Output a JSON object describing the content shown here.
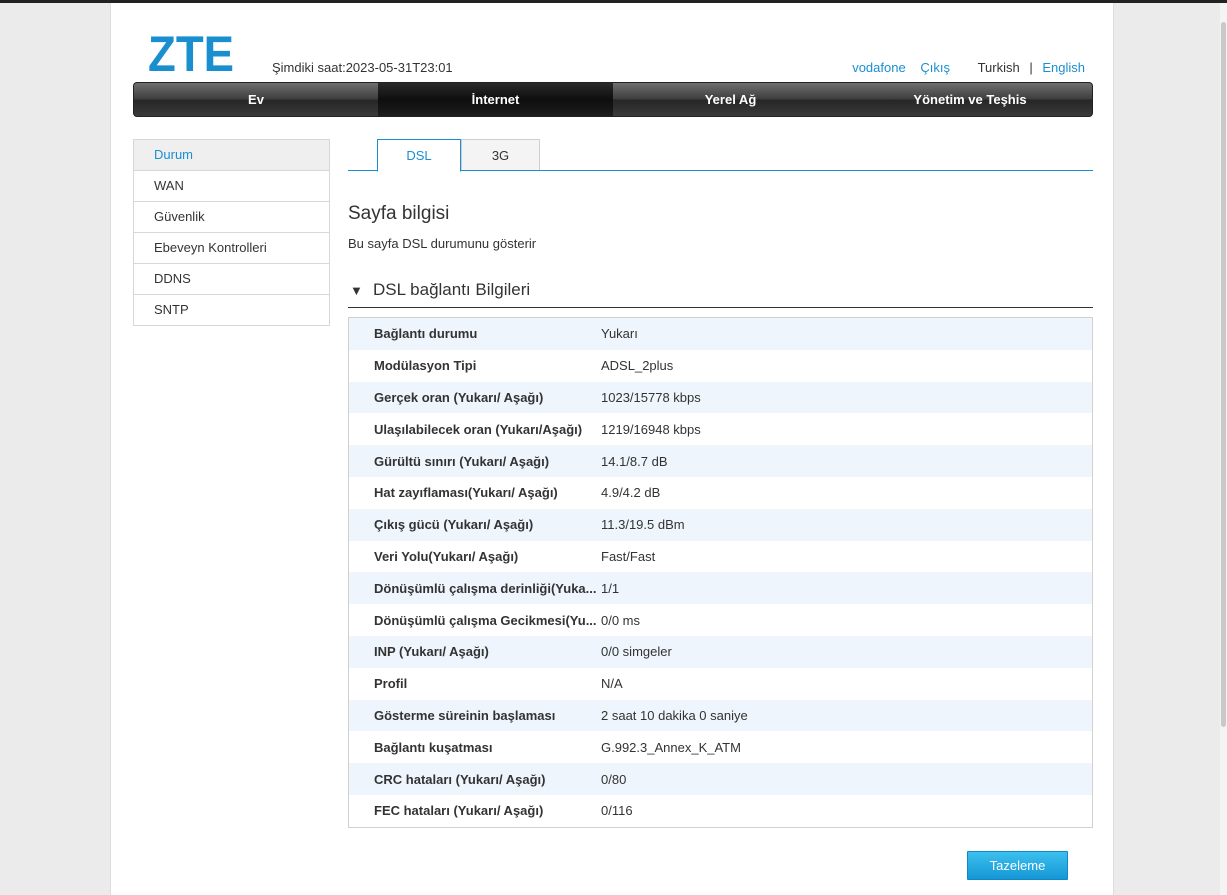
{
  "header": {
    "logo_text": "ZTE",
    "clock": "Şimdiki saat:2023-05-31T23:01",
    "links": {
      "isp": "vodafone",
      "logout": "Çıkış",
      "lang_current": "Turkish",
      "separator": "|",
      "lang_other": "English"
    }
  },
  "nav": [
    "Ev",
    "İnternet",
    "Yerel Ağ",
    "Yönetim ve Teşhis"
  ],
  "sidebar": [
    "Durum",
    "WAN",
    "Güvenlik",
    "Ebeveyn Kontrolleri",
    "DDNS",
    "SNTP"
  ],
  "tabs": [
    "DSL",
    "3G"
  ],
  "page": {
    "title": "Sayfa bilgisi",
    "description": "Bu sayfa DSL durumunu gösterir",
    "section_title": "DSL bağlantı Bilgileri"
  },
  "table": [
    {
      "label": "Bağlantı durumu",
      "value": "Yukarı"
    },
    {
      "label": "Modülasyon Tipi",
      "value": "ADSL_2plus"
    },
    {
      "label": "Gerçek oran (Yukarı/ Aşağı)",
      "value": "1023/15778 kbps"
    },
    {
      "label": "Ulaşılabilecek oran (Yukarı/Aşağı)",
      "value": "1219/16948 kbps"
    },
    {
      "label": "Gürültü sınırı (Yukarı/ Aşağı)",
      "value": "14.1/8.7 dB"
    },
    {
      "label": "Hat zayıflaması(Yukarı/ Aşağı)",
      "value": "4.9/4.2 dB"
    },
    {
      "label": "Çıkış gücü (Yukarı/ Aşağı)",
      "value": "11.3/19.5 dBm"
    },
    {
      "label": "Veri Yolu(Yukarı/ Aşağı)",
      "value": "Fast/Fast"
    },
    {
      "label": "Dönüşümlü çalışma derinliği(Yuka...",
      "value": "1/1"
    },
    {
      "label": "Dönüşümlü çalışma Gecikmesi(Yu...",
      "value": "0/0 ms"
    },
    {
      "label": "INP (Yukarı/ Aşağı)",
      "value": "0/0 simgeler"
    },
    {
      "label": "Profil",
      "value": "N/A"
    },
    {
      "label": "Gösterme süreinin başlaması",
      "value": "2 saat 10 dakika 0 saniye"
    },
    {
      "label": "Bağlantı kuşatması",
      "value": "G.992.3_Annex_K_ATM"
    },
    {
      "label": "CRC hataları (Yukarı/ Aşağı)",
      "value": "0/80"
    },
    {
      "label": "FEC hataları (Yukarı/ Aşağı)",
      "value": "0/116"
    }
  ],
  "refresh_button": "Tazeleme",
  "colors": {
    "accent": "#1a8fd0",
    "logo": "#1a8fd0",
    "row_stripe": "#eef5fc",
    "button": "#1597d6"
  }
}
